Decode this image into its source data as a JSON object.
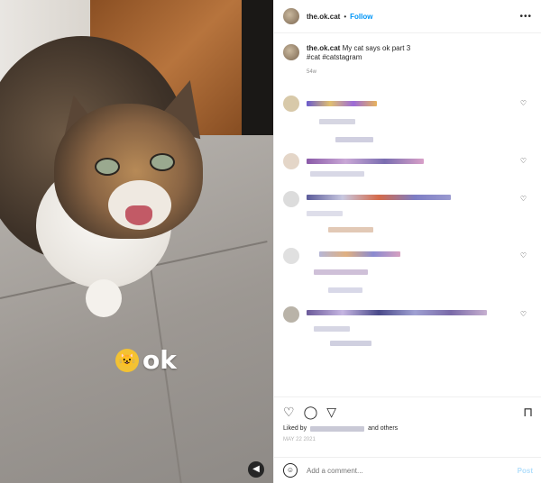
{
  "post": {
    "username": "the.ok.cat",
    "separator": "•",
    "follow_label": "Follow",
    "more_label": "•••",
    "caption_user": "the.ok.cat",
    "caption_text": "My cat says ok part 3",
    "hashtags": "#cat #catstagram",
    "caption_time": "54w"
  },
  "media": {
    "overlay_text": "ok",
    "overlay_emoji": "😺",
    "sound_icon": "speaker-icon"
  },
  "actions": {
    "like_icon": "♡",
    "comment_icon": "◯",
    "share_icon": "▽",
    "save_icon": "⊓",
    "liked_by_label": "Liked by",
    "others_label": "and others",
    "date": "MAY 22 2021"
  },
  "composer": {
    "placeholder": "Add a comment...",
    "post_label": "Post",
    "emoji_icon": "smile-icon"
  },
  "colors": {
    "accent": "#0095f6",
    "post_disabled": "#b2dffc"
  }
}
